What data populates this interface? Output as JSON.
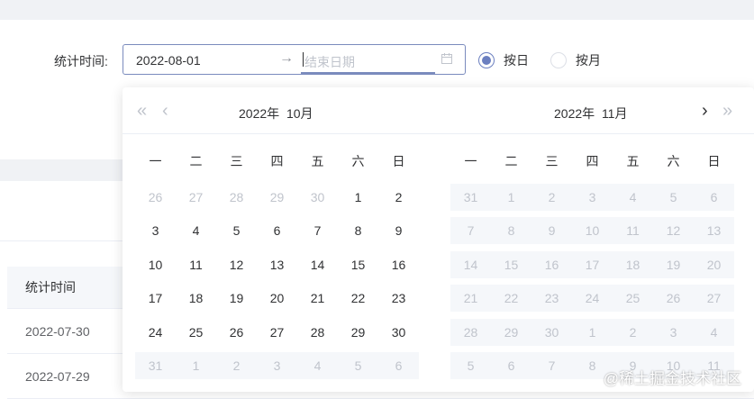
{
  "form": {
    "label": "统计时间:",
    "start_value": "2022-08-01",
    "separator": "→",
    "end_placeholder": "结束日期"
  },
  "mode": {
    "by_day": "按日",
    "by_month": "按月",
    "selected": "by_day"
  },
  "table": {
    "header": "统计时间",
    "rows": [
      "2022-07-30",
      "2022-07-29"
    ]
  },
  "picker": {
    "left_title_year": "2022年",
    "left_title_month": "10月",
    "right_title_year": "2022年",
    "right_title_month": "11月",
    "weekdays": [
      "一",
      "二",
      "三",
      "四",
      "五",
      "六",
      "日"
    ],
    "left_weeks": [
      [
        "26",
        "27",
        "28",
        "29",
        "30",
        "1",
        "2"
      ],
      [
        "3",
        "4",
        "5",
        "6",
        "7",
        "8",
        "9"
      ],
      [
        "10",
        "11",
        "12",
        "13",
        "14",
        "15",
        "16"
      ],
      [
        "17",
        "18",
        "19",
        "20",
        "21",
        "22",
        "23"
      ],
      [
        "24",
        "25",
        "26",
        "27",
        "28",
        "29",
        "30"
      ],
      [
        "31",
        "1",
        "2",
        "3",
        "4",
        "5",
        "6"
      ]
    ],
    "right_weeks": [
      [
        "31",
        "1",
        "2",
        "3",
        "4",
        "5",
        "6"
      ],
      [
        "7",
        "8",
        "9",
        "10",
        "11",
        "12",
        "13"
      ],
      [
        "14",
        "15",
        "16",
        "17",
        "18",
        "19",
        "20"
      ],
      [
        "21",
        "22",
        "23",
        "24",
        "25",
        "26",
        "27"
      ],
      [
        "28",
        "29",
        "30",
        "1",
        "2",
        "3",
        "4"
      ],
      [
        "5",
        "6",
        "7",
        "8",
        "9",
        "10",
        "11"
      ]
    ]
  },
  "colors": {
    "accent": "#6b7fc0",
    "disabled_bg": "#f5f7fa",
    "muted_text": "#c0c4cc"
  },
  "watermark": "@稀土掘金技术社区"
}
